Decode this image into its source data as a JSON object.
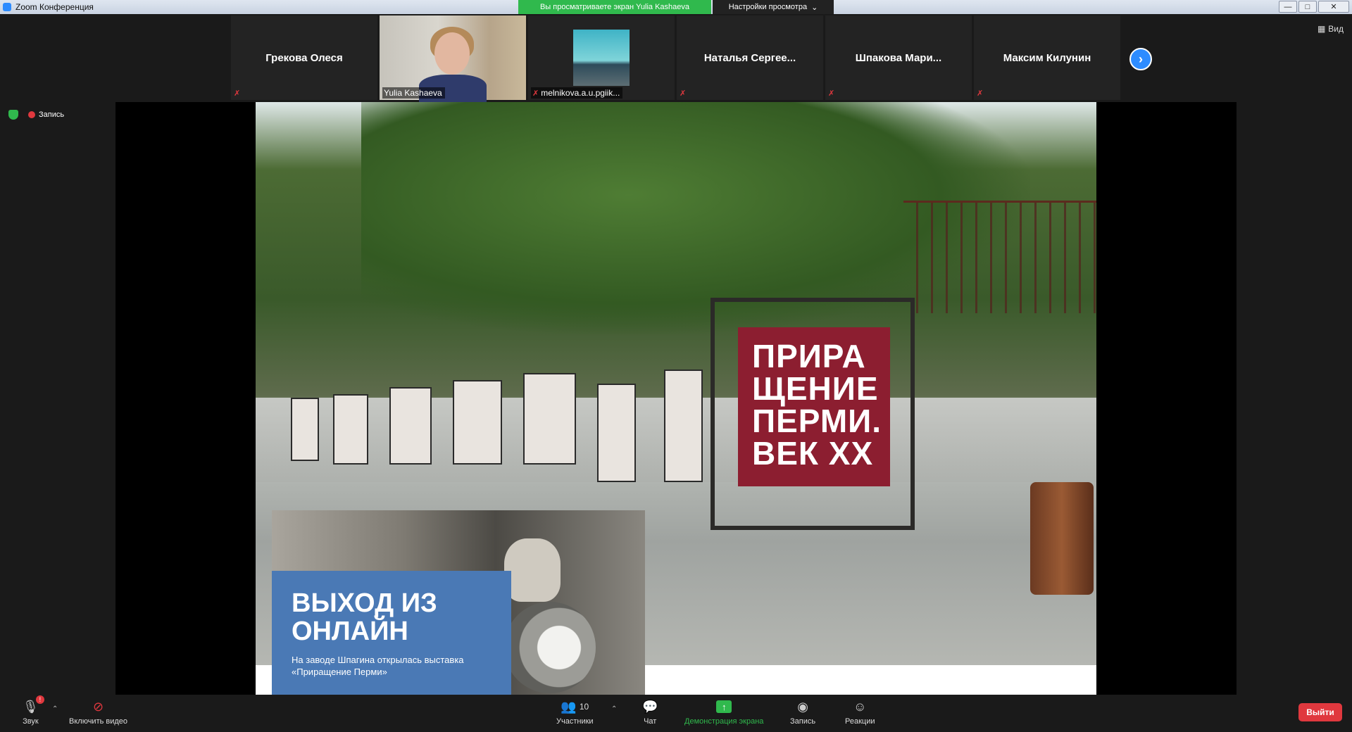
{
  "window": {
    "title": "Zoom Конференция",
    "share_banner": "Вы просматриваете экран Yulia Kashaeva",
    "view_options": "Настройки просмотра",
    "minimize": "—",
    "maximize": "□",
    "close": "✕"
  },
  "gallery": {
    "tiles": [
      {
        "name": "Грекова Олеся"
      },
      {
        "name": "Yulia Kashaeva"
      },
      {
        "name": "melnikova.a.u.pgiik..."
      },
      {
        "name": "Наталья  Сергее..."
      },
      {
        "name": "Шпакова  Мари..."
      },
      {
        "name": "Максим Килунин"
      }
    ],
    "next_icon": "chevron-right",
    "view_label": "Вид"
  },
  "status": {
    "recording": "Запись"
  },
  "shared_slide": {
    "poster_text": "ПРИРА ЩЕНИЕ ПЕРМИ. ВЕК XX",
    "headline": "ВЫХОД ИЗ ОНЛАЙН",
    "subtext": "На заводе Шпагина открылась выставка «Приращение Перми»"
  },
  "toolbar": {
    "audio": "Звук",
    "video": "Включить видео",
    "participants": "Участники",
    "participants_count": "10",
    "chat": "Чат",
    "share": "Демонстрация экрана",
    "record": "Запись",
    "reactions": "Реакции",
    "leave": "Выйти",
    "audio_badge": "!"
  },
  "colors": {
    "share_green": "#30b94d",
    "zoom_blue": "#2d8cff",
    "leave_red": "#e0383e",
    "poster_red": "#8c1e30",
    "inset_blue": "#4a79b5"
  }
}
